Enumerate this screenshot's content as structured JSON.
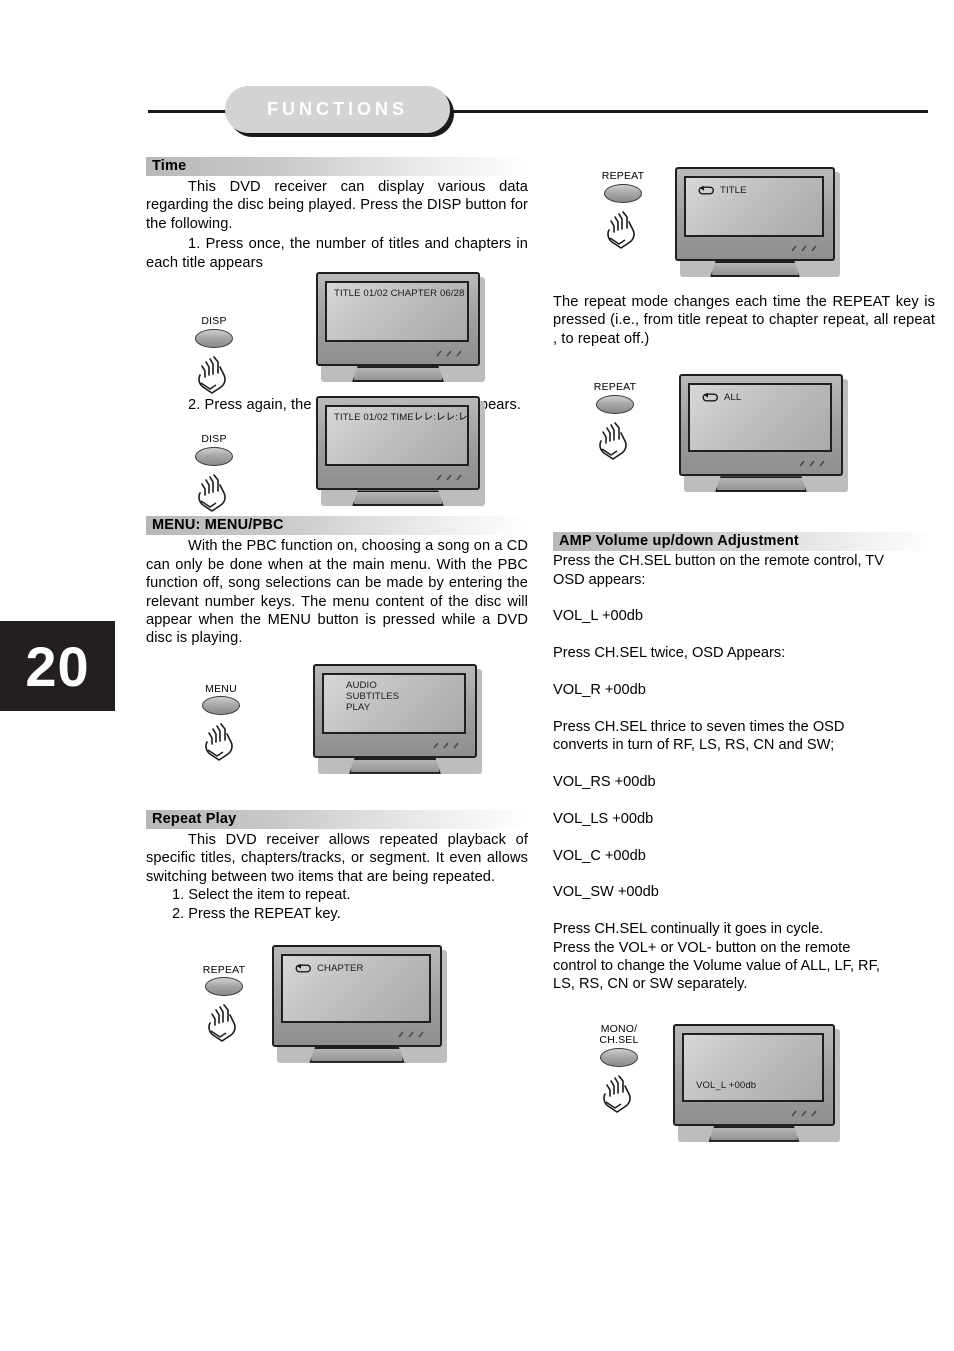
{
  "page": {
    "number": "20",
    "header_title": "FUNCTIONS"
  },
  "left_column": {
    "time_section": {
      "heading": "Time",
      "paragraph1": "This DVD receiver can display various data regarding the disc being played. Press the DISP button for the following.",
      "step1": "1. Press once, the number of titles and chapters in each title appears",
      "step2": "2. Press again, the time of a selected title appears.",
      "figure1": {
        "button_label": "DISP",
        "osd_text": "TITLE 01/02 CHAPTER 06/28"
      },
      "figure2": {
        "button_label": "DISP",
        "osd_text": "TITLE 01/02 TIME㆑㆑:㆑㆑:㆑㆑"
      }
    },
    "menu_section": {
      "heading": "MENU: MENU/PBC",
      "paragraph": "With the PBC function on, choosing a song on a CD can only be done when at the main menu. With the PBC function off, song selections can be made by entering the relevant number keys. The menu content of the disc will appear when the MENU button is pressed while a DVD disc is playing.",
      "figure": {
        "button_label": "MENU",
        "osd_line1": "AUDIO",
        "osd_line2": "SUBTITLES",
        "osd_line3": "PLAY"
      }
    },
    "repeat_section": {
      "heading": "Repeat Play",
      "paragraph": "This DVD receiver allows repeated playback of specific titles, chapters/tracks, or segment. It even allows switching between two items that are being repeated.",
      "step1": "1. Select the item to repeat.",
      "step2": "2. Press the REPEAT key.",
      "figure": {
        "button_label": "REPEAT",
        "osd_text": "CHAPTER",
        "osd_icon": "repeat-loop-icon"
      }
    }
  },
  "right_column": {
    "repeat_title_figure": {
      "button_label": "REPEAT",
      "osd_text": "TITLE",
      "osd_icon": "repeat-loop-icon"
    },
    "repeat_paragraph": "The repeat mode changes each time the REPEAT key is pressed (i.e., from title repeat to chapter repeat, all repeat , to repeat off.)",
    "repeat_all_figure": {
      "button_label": "REPEAT",
      "osd_text": "ALL",
      "osd_icon": "repeat-loop-icon"
    },
    "amp_section": {
      "heading": "AMP Volume up/down Adjustment",
      "lines": [
        "Press the CH.SEL button on the remote control, TV",
        "OSD appears:",
        "",
        "VOL_L +00db",
        "",
        "Press CH.SEL twice, OSD Appears:",
        "",
        "VOL_R +00db",
        "",
        "Press CH.SEL thrice to seven times the OSD",
        "converts in turn of RF, LS, RS, CN and SW;",
        "",
        "VOL_RS +00db",
        "",
        "VOL_LS +00db",
        "",
        "VOL_C +00db",
        "",
        "VOL_SW +00db",
        "",
        "Press CH.SEL continually it goes in cycle.",
        "Press the VOL+ or VOL- button on the remote",
        "control to change the Volume value of ALL, LF, RF,",
        "LS, RS, CN or SW separately."
      ],
      "figure": {
        "button_label": "MONO/\nCH.SEL",
        "osd_text": "VOL_L +00db"
      }
    }
  }
}
